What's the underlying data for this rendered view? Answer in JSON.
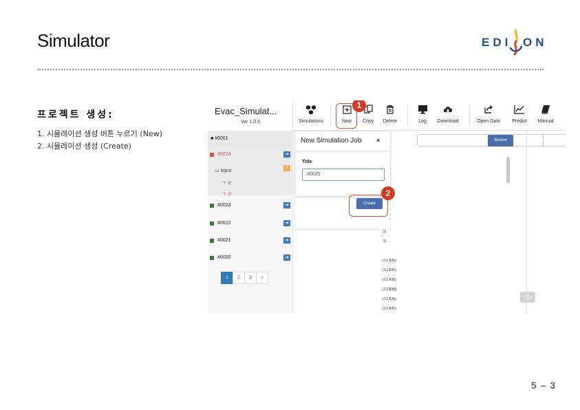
{
  "slide": {
    "title": "Simulator",
    "logo": {
      "left": "EDI",
      "right": "ON",
      "colors": {
        "blue": "#1f4f8f",
        "yellow": "#f2b51c",
        "red": "#e0422b"
      }
    },
    "page_number": "5 – 3"
  },
  "section": {
    "heading": "프로젝트 생성:",
    "steps": [
      "1. 시뮬레이션 생성 버튼 누르기 (New)",
      "2. 시뮬레이션 생성 (Create)"
    ]
  },
  "app": {
    "name": "Evac_Simulat...",
    "version": "Ver 1.0.6",
    "toolbar": [
      {
        "label": "Simulations",
        "icon": "simulations-icon"
      },
      {
        "label": "New",
        "icon": "new-plus-icon"
      },
      {
        "label": "Copy",
        "icon": "copy-icon"
      },
      {
        "label": "Delete",
        "icon": "trash-icon"
      },
      {
        "label": "Log",
        "icon": "monitor-icon"
      },
      {
        "label": "Download",
        "icon": "cloud-download-icon"
      },
      {
        "label": "Open Data",
        "icon": "share-icon"
      },
      {
        "label": "Predict",
        "icon": "chart-icon"
      },
      {
        "label": "Manual",
        "icon": "book-icon"
      }
    ],
    "sidebar": {
      "root": "#0001",
      "jobs": [
        {
          "label": "#0024",
          "active": true
        },
        {
          "label": "#0023"
        },
        {
          "label": "#0022"
        },
        {
          "label": "#0021"
        },
        {
          "label": "#0020"
        }
      ],
      "input_label": "Input",
      "input_count": "2",
      "sub_items": [
        "ㄱ ㄹ",
        "ㄱ ㄹ"
      ],
      "pagination": [
        "1",
        "2",
        "3",
        "»"
      ],
      "active_page": "1"
    },
    "menu_button": "Menu▾",
    "file_sizes": [
      "(12 KB)",
      "(12 KB)",
      "(12 KB)",
      "(12 KB)",
      "(12 KB)",
      "(12 KB)"
    ],
    "modal": {
      "title": "New Simulation Job",
      "close": "×",
      "field_label": "Title",
      "field_value": "#0025",
      "create_label": "Create"
    },
    "callouts": [
      "1",
      "2"
    ],
    "accent": "#4a6ea9",
    "highlight_color": "#d9532c"
  }
}
